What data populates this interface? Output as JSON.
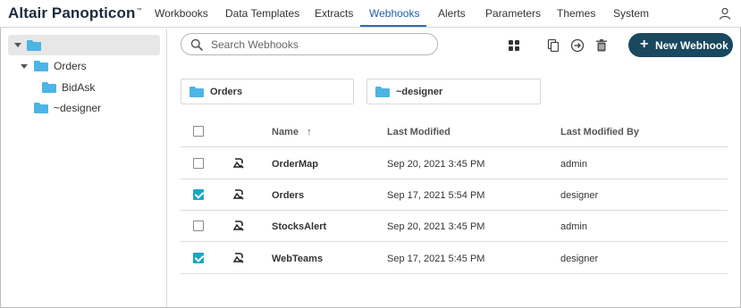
{
  "app": {
    "brand": "Altair Panopticon",
    "trademark": "™"
  },
  "nav": {
    "items": [
      {
        "label": "Workbooks",
        "active": false
      },
      {
        "label": "Data Templates",
        "active": false
      },
      {
        "label": "Extracts",
        "active": false
      },
      {
        "label": "Webhooks",
        "active": true
      },
      {
        "label": "Alerts",
        "active": false
      },
      {
        "label": "Parameters",
        "active": false
      },
      {
        "label": "Themes",
        "active": false
      },
      {
        "label": "System",
        "active": false
      }
    ],
    "user_icon": "user-icon"
  },
  "sidebar": {
    "tree": [
      {
        "label": "",
        "expanded": true,
        "selected": true
      },
      {
        "label": "Orders",
        "expanded": true
      },
      {
        "label": "BidAsk"
      },
      {
        "label": "~designer"
      }
    ]
  },
  "toolbar": {
    "search_placeholder": "Search Webhooks",
    "icons": [
      "grid-view-icon",
      "copy-icon",
      "move-icon",
      "delete-icon"
    ],
    "new_button": "New Webhook"
  },
  "folders": [
    {
      "label": "Orders"
    },
    {
      "label": "~designer"
    }
  ],
  "table": {
    "columns": {
      "name": "Name",
      "sort_indicator": "↑",
      "modified": "Last Modified",
      "modified_by": "Last Modified By"
    },
    "rows": [
      {
        "name": "OrderMap",
        "modified": "Sep 20, 2021 3:45 PM",
        "by": "admin",
        "checked": false
      },
      {
        "name": "Orders",
        "modified": "Sep 17, 2021 5:54 PM",
        "by": "designer",
        "checked": true
      },
      {
        "name": "StocksAlert",
        "modified": "Sep 20, 2021 3:45 PM",
        "by": "admin",
        "checked": false
      },
      {
        "name": "WebTeams",
        "modified": "Sep 17, 2021 5:45 PM",
        "by": "designer",
        "checked": true
      }
    ]
  },
  "colors": {
    "accent": "#19485f",
    "active_tab": "#2d6fb0",
    "folder": "#4db4e6",
    "checkbox": "#19a7c6"
  }
}
